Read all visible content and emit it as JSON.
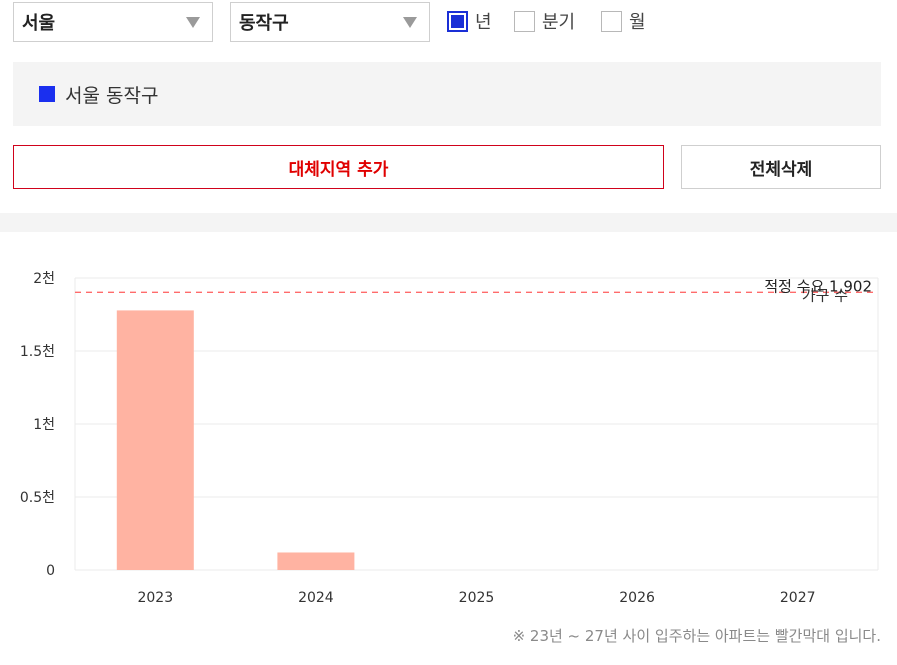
{
  "filters": {
    "city": "서울",
    "district": "동작구",
    "periods": [
      {
        "label": "년",
        "checked": true
      },
      {
        "label": "분기",
        "checked": false
      },
      {
        "label": "월",
        "checked": false
      }
    ]
  },
  "selected_region": {
    "label": "서울 동작구",
    "color": "#1a2fef"
  },
  "actions": {
    "add_region": "대체지역 추가",
    "delete_all": "전체삭제"
  },
  "chart_data": {
    "type": "bar",
    "categories": [
      "2023",
      "2024",
      "2025",
      "2026",
      "2027"
    ],
    "values": [
      1778,
      120,
      0,
      0,
      0
    ],
    "bar_color": "#ffb3a2",
    "ylim": [
      0,
      2000
    ],
    "y_ticks": [
      {
        "value": 0,
        "label": "0"
      },
      {
        "value": 500,
        "label": "0.5천"
      },
      {
        "value": 1000,
        "label": "1천"
      },
      {
        "value": 1500,
        "label": "1.5천"
      },
      {
        "value": 2000,
        "label": "2천"
      }
    ],
    "reference_line": {
      "value": 1902,
      "label": "적정 수요 1,902",
      "sublabel": "가구 수",
      "color": "#ff6b6b"
    },
    "grid": true
  },
  "note": "※ 23년 ~ 27년 사이 입주하는 아파트는 빨간막대 입니다."
}
